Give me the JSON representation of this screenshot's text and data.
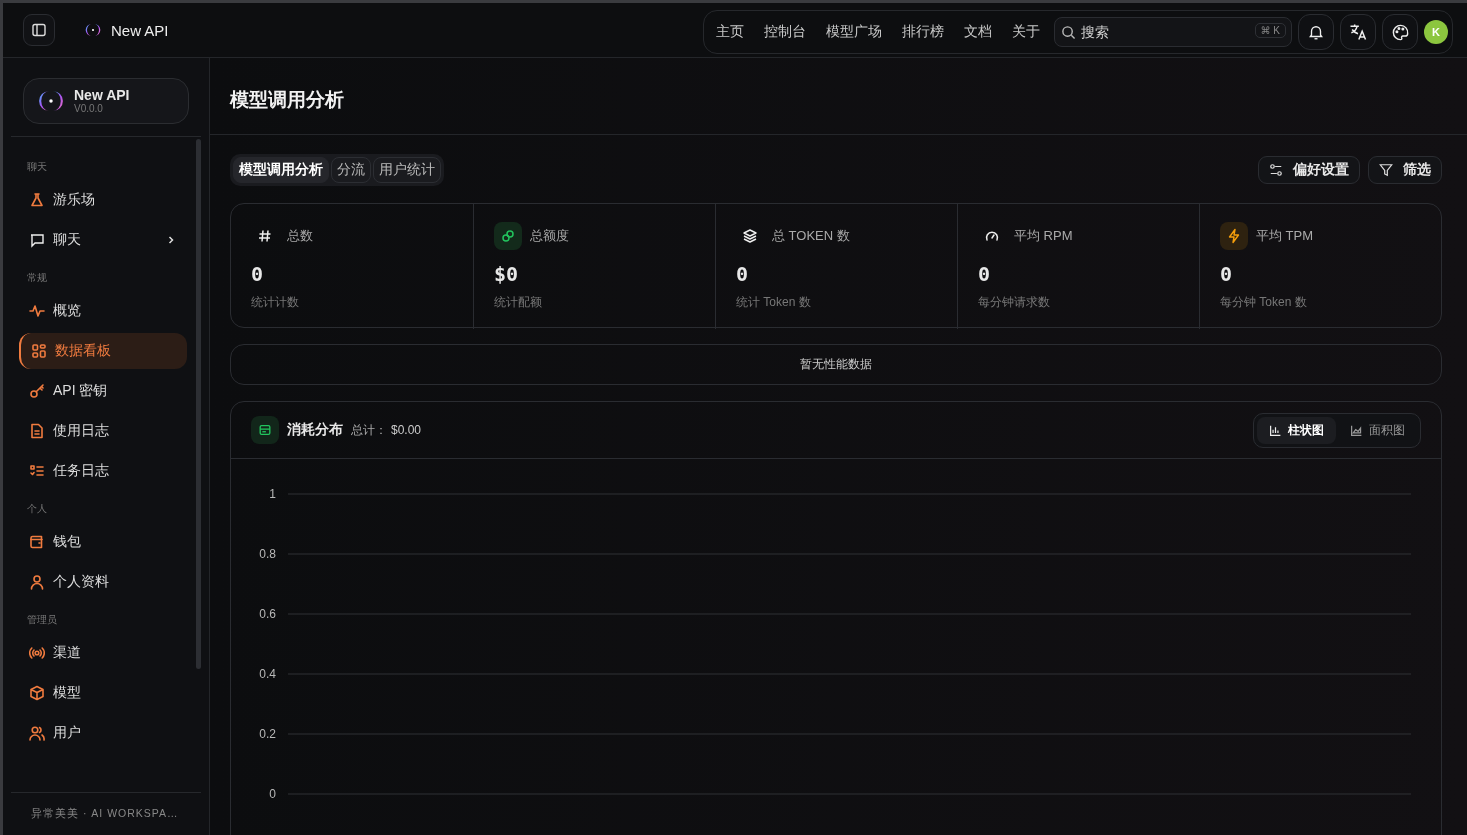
{
  "top_bar": {
    "app_name": "New API",
    "nav": [
      {
        "label": "主页",
        "selected": false
      },
      {
        "label": "控制台",
        "selected": false
      },
      {
        "label": "模型广场",
        "selected": false
      },
      {
        "label": "排行榜",
        "selected": false
      },
      {
        "label": "文档",
        "selected": false
      },
      {
        "label": "关于",
        "selected": false
      }
    ],
    "search": {
      "placeholder": "搜索",
      "shortcut": "⌘ K"
    },
    "avatar": "K"
  },
  "sidebar": {
    "brand": {
      "name": "New API",
      "version": "V0.0.0"
    },
    "sections": [
      {
        "title": "聊天",
        "items": [
          {
            "label": "游乐场",
            "selected": false
          },
          {
            "label": "聊天",
            "selected": false,
            "expanded": false
          }
        ]
      },
      {
        "title": "常规",
        "items": [
          {
            "label": "概览",
            "selected": false
          },
          {
            "label": "数据看板",
            "selected": true
          },
          {
            "label": "API 密钥",
            "selected": false
          },
          {
            "label": "使用日志",
            "selected": false
          },
          {
            "label": "任务日志",
            "selected": false
          }
        ]
      },
      {
        "title": "个人",
        "items": [
          {
            "label": "钱包",
            "selected": false
          },
          {
            "label": "个人资料",
            "selected": false
          }
        ]
      },
      {
        "title": "管理员",
        "items": [
          {
            "label": "渠道",
            "selected": false
          },
          {
            "label": "模型",
            "selected": false
          },
          {
            "label": "用户",
            "selected": false
          }
        ]
      }
    ],
    "footer": "异常美美 · AI WORKSPA…"
  },
  "page": {
    "title": "模型调用分析",
    "tabs": [
      {
        "label": "模型调用分析",
        "selected": true
      },
      {
        "label": "分流",
        "selected": false
      },
      {
        "label": "用户统计",
        "selected": false
      }
    ],
    "actions": [
      "偏好设置",
      "筛选"
    ],
    "stats": [
      {
        "label": "总数",
        "value": "0",
        "caption": "统计计数"
      },
      {
        "label": "总额度",
        "value": "$0",
        "caption": "统计配额"
      },
      {
        "label": "总 TOKEN 数",
        "value": "0",
        "caption": "统计 Token 数"
      },
      {
        "label": "平均 RPM",
        "value": "0",
        "caption": "每分钟请求数"
      },
      {
        "label": "平均 TPM",
        "value": "0",
        "caption": "每分钟 Token 数"
      }
    ],
    "performance_notice": "暂无性能数据",
    "consumption": {
      "title": "消耗分布",
      "total_label": "总计：",
      "total": "$0.00",
      "chart_types": [
        {
          "label": "柱状图",
          "selected": true
        },
        {
          "label": "面积图",
          "selected": false
        }
      ],
      "empty_chart_axis_labels": [
        "1",
        "0.8",
        "0.6",
        "0.4",
        "0.2",
        "0"
      ]
    }
  }
}
